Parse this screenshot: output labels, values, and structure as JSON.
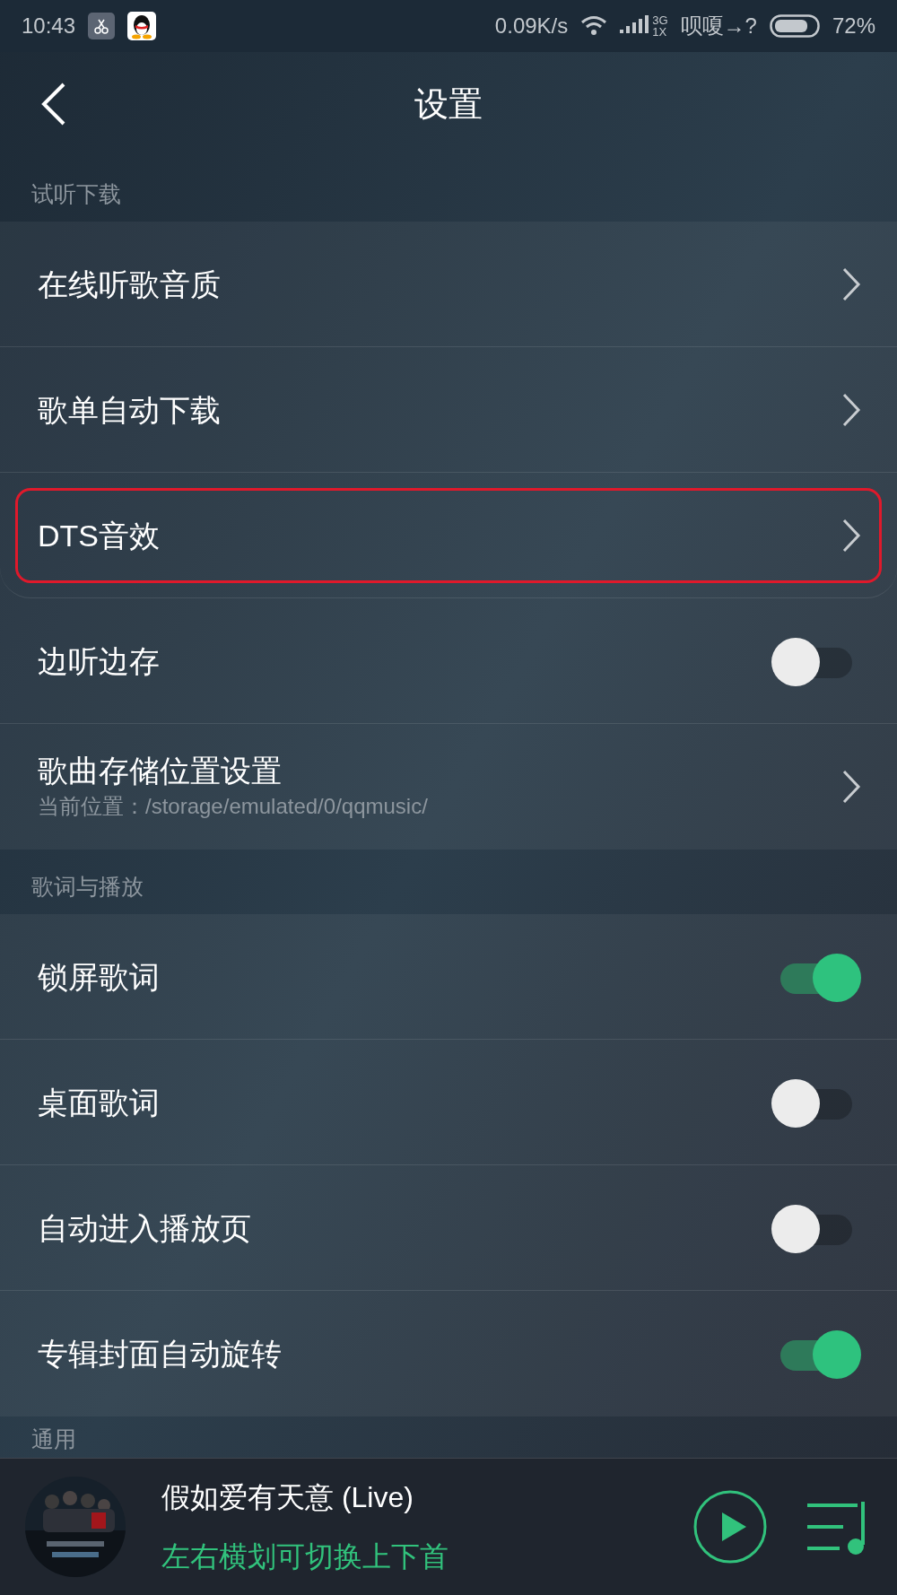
{
  "status_bar": {
    "time": "10:43",
    "speed": "0.09K/s",
    "network": "3G",
    "network_sub": "1X",
    "carrier": "呗嗄→?",
    "battery": "72%"
  },
  "header": {
    "title": "设置"
  },
  "sections": [
    {
      "title": "试听下载",
      "items": [
        {
          "kind": "link",
          "label": "在线听歌音质",
          "highlighted": false
        },
        {
          "kind": "link",
          "label": "歌单自动下载",
          "highlighted": false
        },
        {
          "kind": "link",
          "label": "DTS音效",
          "highlighted": true
        },
        {
          "kind": "toggle",
          "label": "边听边存",
          "on": false
        },
        {
          "kind": "link",
          "label": "歌曲存储位置设置",
          "subtitle": "当前位置：/storage/emulated/0/qqmusic/",
          "highlighted": false
        }
      ]
    },
    {
      "title": "歌词与播放",
      "items": [
        {
          "kind": "toggle",
          "label": "锁屏歌词",
          "on": true
        },
        {
          "kind": "toggle",
          "label": "桌面歌词",
          "on": false
        },
        {
          "kind": "toggle",
          "label": "自动进入播放页",
          "on": false
        },
        {
          "kind": "toggle",
          "label": "专辑封面自动旋转",
          "on": true
        }
      ]
    },
    {
      "title": "通用"
    }
  ],
  "player": {
    "song": "假如爱有天意 (Live)",
    "hint": "左右横划可切换上下首"
  }
}
